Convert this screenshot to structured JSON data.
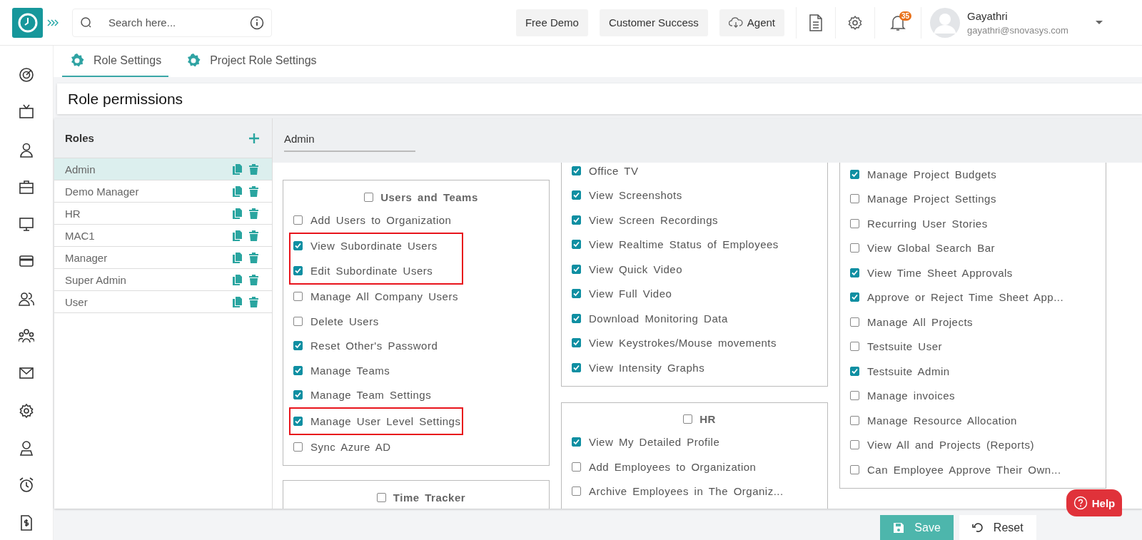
{
  "header": {
    "search": {
      "placeholder": "Search here..."
    },
    "buttons": [
      {
        "label": "Free Demo",
        "kind": "plain"
      },
      {
        "label": "Customer Success",
        "kind": "plain"
      },
      {
        "label": "Agent",
        "kind": "cloud"
      }
    ],
    "notifications": "35",
    "user": {
      "name": "Gayathri",
      "email": "gayathri@snovasys.com"
    }
  },
  "tabs": [
    {
      "label": "Role Settings",
      "selected": true
    },
    {
      "label": "Project Role Settings",
      "selected": false
    }
  ],
  "page_title": "Role permissions",
  "roles": {
    "title": "Roles",
    "items": [
      {
        "name": "Admin",
        "selected": true
      },
      {
        "name": "Demo Manager",
        "selected": false
      },
      {
        "name": "HR",
        "selected": false
      },
      {
        "name": "MAC1",
        "selected": false
      },
      {
        "name": "Manager",
        "selected": false
      },
      {
        "name": "Super Admin",
        "selected": false
      },
      {
        "name": "User",
        "selected": false
      }
    ]
  },
  "role_name": "Admin",
  "columns": [
    {
      "cards": [
        {
          "title": "Users and Teams",
          "checked": false,
          "items": [
            {
              "label": "Add Users to Organization",
              "checked": false,
              "highlighted": false
            },
            {
              "label": "View Subordinate Users",
              "checked": true,
              "highlighted": true
            },
            {
              "label": "Edit Subordinate Users",
              "checked": true,
              "highlighted": true
            },
            {
              "label": "Manage All Company Users",
              "checked": false,
              "highlighted": false
            },
            {
              "label": "Delete Users",
              "checked": false,
              "highlighted": false
            },
            {
              "label": "Reset Other's Password",
              "checked": true,
              "highlighted": false
            },
            {
              "label": "Manage Teams",
              "checked": true,
              "highlighted": false
            },
            {
              "label": "Manage Team Settings",
              "checked": true,
              "highlighted": false
            },
            {
              "label": "Manage User Level Settings",
              "checked": true,
              "highlighted": true
            },
            {
              "label": "Sync Azure AD",
              "checked": false,
              "highlighted": false
            }
          ]
        },
        {
          "title": "Time Tracker",
          "checked": false
        }
      ]
    },
    {
      "cards": [
        {
          "items": [
            {
              "label": "Office TV",
              "checked": true,
              "highlighted": false
            },
            {
              "label": "View Screenshots",
              "checked": true,
              "highlighted": false
            },
            {
              "label": "View Screen Recordings",
              "checked": true,
              "highlighted": false
            },
            {
              "label": "View Realtime Status of Employees",
              "checked": true,
              "highlighted": false
            },
            {
              "label": "View Quick Video",
              "checked": true,
              "highlighted": false
            },
            {
              "label": "View Full Video",
              "checked": true,
              "highlighted": false
            },
            {
              "label": "Download Monitoring Data",
              "checked": true,
              "highlighted": false
            },
            {
              "label": "View Keystrokes/Mouse movements",
              "checked": true,
              "highlighted": false
            },
            {
              "label": "View Intensity Graphs",
              "checked": true,
              "highlighted": false
            }
          ]
        },
        {
          "title": "HR",
          "checked": false,
          "items": [
            {
              "label": "View My Detailed Profile",
              "checked": true,
              "highlighted": false
            },
            {
              "label": "Add Employees to Organization",
              "checked": false,
              "highlighted": false
            },
            {
              "label": "Archive Employees in The Organiz...",
              "checked": false,
              "highlighted": false
            }
          ]
        }
      ]
    },
    {
      "cards": [
        {
          "items": [
            {
              "label": "Manage Project Budgets",
              "checked": true,
              "highlighted": false
            },
            {
              "label": "Manage Project Settings",
              "checked": false,
              "highlighted": false
            },
            {
              "label": "Recurring User Stories",
              "checked": false,
              "highlighted": false
            },
            {
              "label": "View Global Search Bar",
              "checked": false,
              "highlighted": false
            },
            {
              "label": "View Time Sheet Approvals",
              "checked": true,
              "highlighted": false
            },
            {
              "label": "Approve or Reject Time Sheet App...",
              "checked": true,
              "highlighted": false
            },
            {
              "label": "Manage All Projects",
              "checked": false,
              "highlighted": false
            },
            {
              "label": "Testsuite User",
              "checked": false,
              "highlighted": false
            },
            {
              "label": "Testsuite Admin",
              "checked": true,
              "highlighted": false
            },
            {
              "label": "Manage invoices",
              "checked": false,
              "highlighted": false
            },
            {
              "label": "Manage Resource Allocation",
              "checked": false,
              "highlighted": false
            },
            {
              "label": "View All and Projects (Reports)",
              "checked": false,
              "highlighted": false
            },
            {
              "label": "Can Employee Approve Their Own...",
              "checked": false,
              "highlighted": false
            }
          ]
        }
      ]
    }
  ],
  "footer": {
    "save": "Save",
    "reset": "Reset"
  },
  "help": "Help"
}
